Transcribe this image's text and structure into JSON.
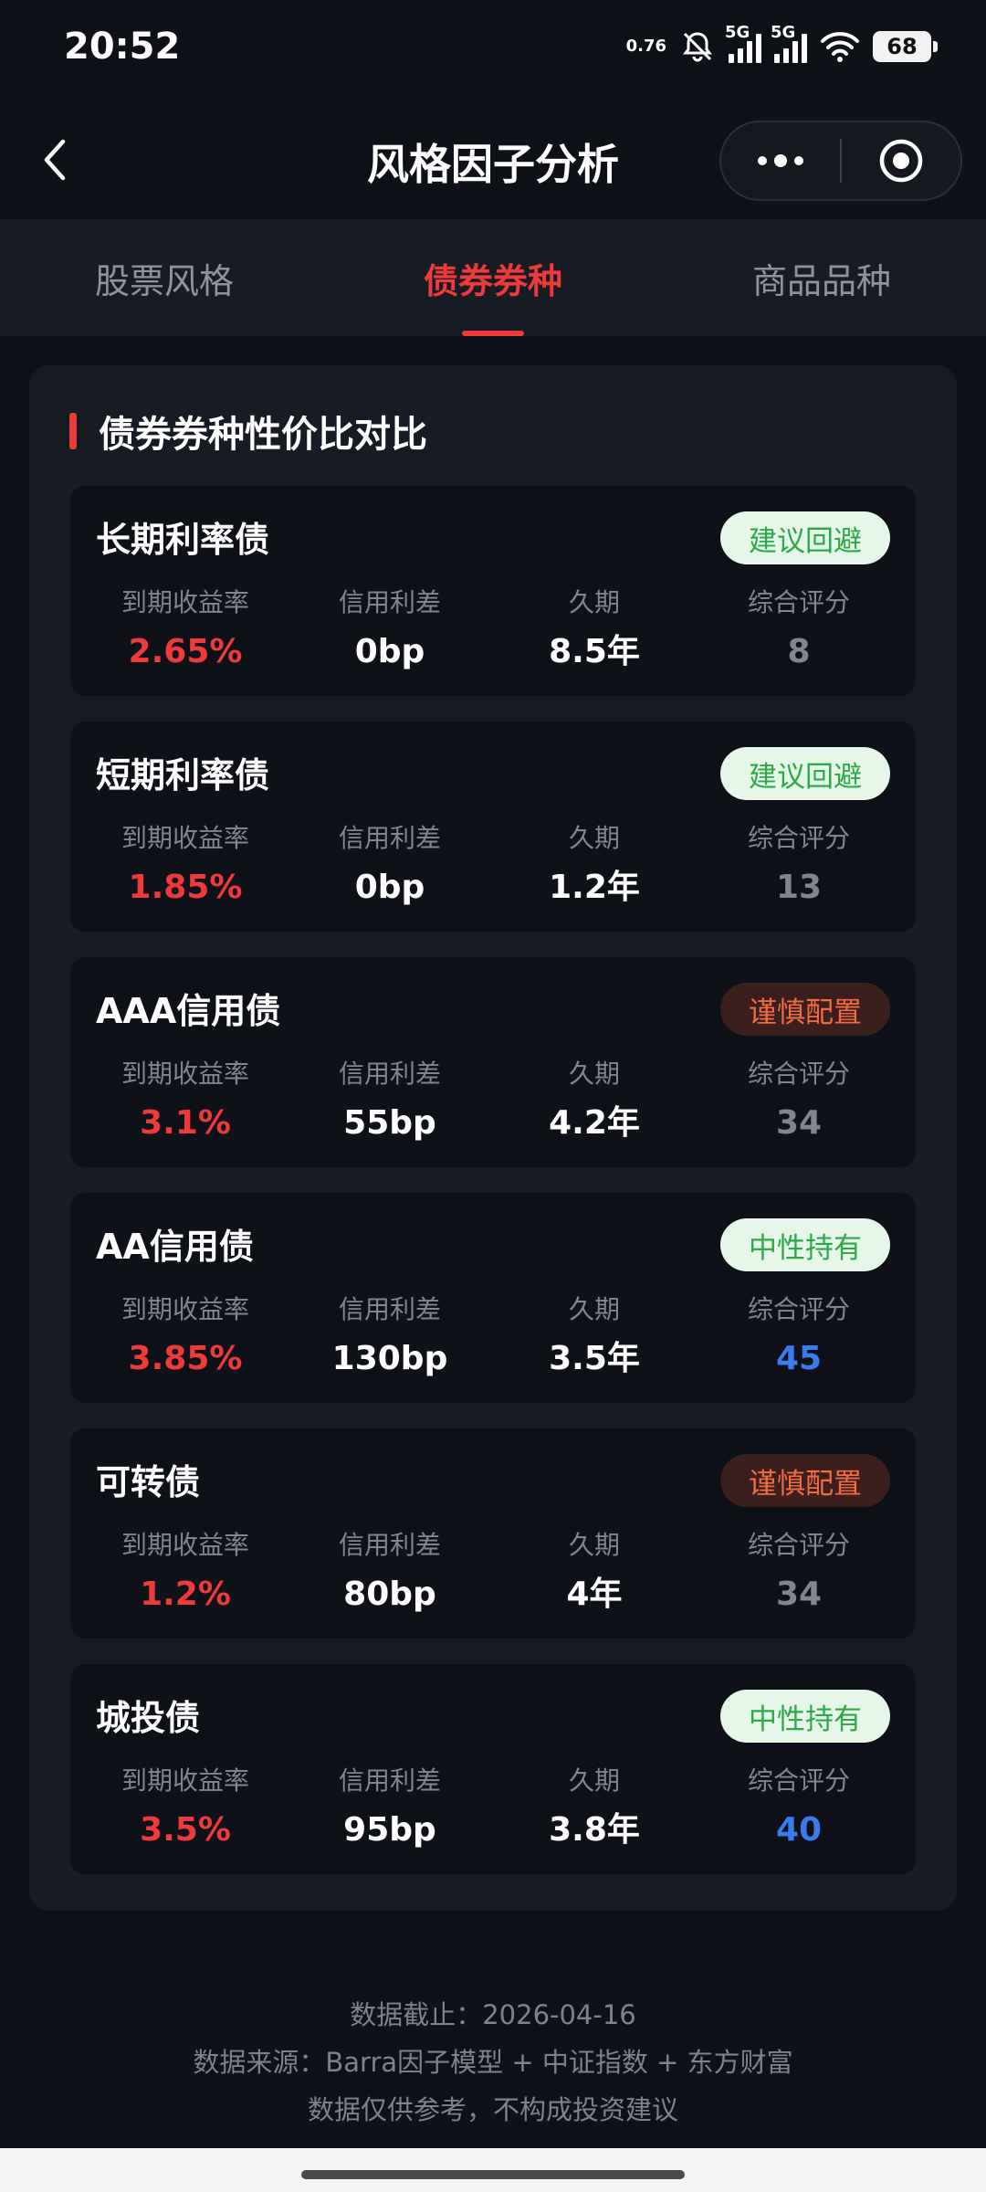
{
  "status": {
    "time": "20:52",
    "net_speed": "0.76",
    "signal1": "5G",
    "signal2": "5G",
    "battery": "68"
  },
  "nav": {
    "title": "风格因子分析",
    "icons": {
      "back": "chevron-left-icon",
      "more": "more-dots-icon",
      "close": "target-circle-icon"
    }
  },
  "tabs": [
    {
      "label": "股票风格",
      "active": false
    },
    {
      "label": "债券券种",
      "active": true
    },
    {
      "label": "商品品种",
      "active": false
    }
  ],
  "panel": {
    "title": "债券券种性价比对比",
    "metric_labels": {
      "yield": "到期收益率",
      "spread": "信用利差",
      "duration": "久期",
      "score": "综合评分"
    },
    "bonds": [
      {
        "name": "长期利率债",
        "badge": "建议回避",
        "badge_tone": "green",
        "yield": "2.65%",
        "spread": "0bp",
        "duration": "8.5年",
        "score": "8",
        "score_tone": "gray"
      },
      {
        "name": "短期利率债",
        "badge": "建议回避",
        "badge_tone": "green",
        "yield": "1.85%",
        "spread": "0bp",
        "duration": "1.2年",
        "score": "13",
        "score_tone": "gray"
      },
      {
        "name": "AAA信用债",
        "badge": "谨慎配置",
        "badge_tone": "red",
        "yield": "3.1%",
        "spread": "55bp",
        "duration": "4.2年",
        "score": "34",
        "score_tone": "gray"
      },
      {
        "name": "AA信用债",
        "badge": "中性持有",
        "badge_tone": "green",
        "yield": "3.85%",
        "spread": "130bp",
        "duration": "3.5年",
        "score": "45",
        "score_tone": "blue"
      },
      {
        "name": "可转债",
        "badge": "谨慎配置",
        "badge_tone": "red",
        "yield": "1.2%",
        "spread": "80bp",
        "duration": "4年",
        "score": "34",
        "score_tone": "gray"
      },
      {
        "name": "城投债",
        "badge": "中性持有",
        "badge_tone": "green",
        "yield": "3.5%",
        "spread": "95bp",
        "duration": "3.8年",
        "score": "40",
        "score_tone": "blue"
      }
    ]
  },
  "footer": {
    "date_line": "数据截止：2026-04-16",
    "source_line": "数据来源：Barra因子模型 + 中证指数 + 东方财富",
    "disclaimer": "数据仅供参考，不构成投资建议"
  },
  "colors": {
    "accent_red": "#ee3a3a",
    "badge_green_text": "#2ea94a",
    "badge_red_text": "#f36b43",
    "score_blue": "#3a7bf0"
  }
}
